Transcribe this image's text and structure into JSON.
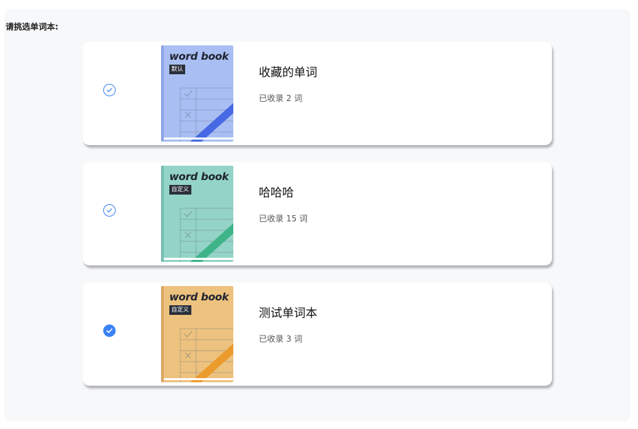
{
  "prompt_label": "请挑选单词本:",
  "books": [
    {
      "name": "收藏的单词",
      "count_text": "已收录 2 词",
      "cover_title": "word book",
      "cover_tag": "默认",
      "cover_color": "#a9bff3",
      "spine_color": "#8ea6e6",
      "stripe_color": "#4769e3",
      "selected": false
    },
    {
      "name": "哈哈哈",
      "count_text": "已收录 15 词",
      "cover_title": "word book",
      "cover_tag": "自定义",
      "cover_color": "#94d4c7",
      "spine_color": "#75bfb0",
      "stripe_color": "#3fb489",
      "selected": false
    },
    {
      "name": "测试单词本",
      "count_text": "已收录 3 词",
      "cover_title": "word book",
      "cover_tag": "自定义",
      "cover_color": "#edc27e",
      "spine_color": "#dba862",
      "stripe_color": "#eb9a2c",
      "selected": true
    }
  ],
  "colors": {
    "accent": "#3b82f6",
    "panel_bg": "#f7f8fa"
  },
  "icons": {
    "unchecked": "circle-check-outline-icon",
    "checked": "circle-check-filled-icon"
  }
}
